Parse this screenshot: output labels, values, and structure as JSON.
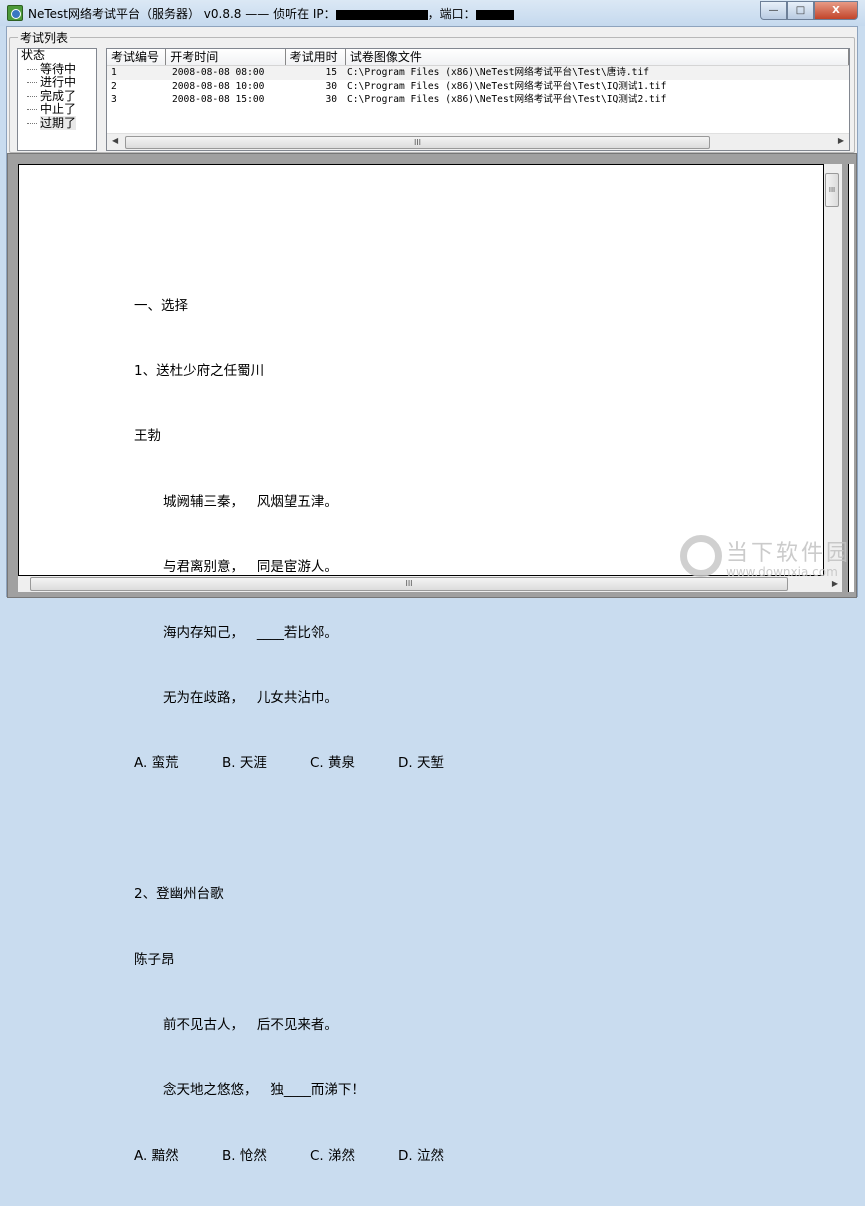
{
  "window": {
    "title": "NeTest网络考试平台（服务器） v0.8.8 —— 侦听在 IP：",
    "port_label": "，端口：",
    "minimize": "—",
    "maximize": "□",
    "close": "X"
  },
  "group": {
    "label": "考试列表"
  },
  "tree": {
    "root": "状态",
    "items": [
      "等待中",
      "进行中",
      "完成了",
      "中止了",
      "过期了"
    ]
  },
  "table": {
    "headers": [
      "考试编号",
      "开考时间",
      "考试用时",
      "试卷图像文件"
    ],
    "rows": [
      [
        "1",
        "2008-08-08 08:00",
        "15",
        "C:\\Program Files (x86)\\NeTest网络考试平台\\Test\\唐诗.tif"
      ],
      [
        "2",
        "2008-08-08 10:00",
        "30",
        "C:\\Program Files (x86)\\NeTest网络考试平台\\Test\\IQ测试1.tif"
      ],
      [
        "3",
        "2008-08-08 15:00",
        "30",
        "C:\\Program Files (x86)\\NeTest网络考试平台\\Test\\IQ测试2.tif"
      ]
    ]
  },
  "scroll": {
    "grip": "III"
  },
  "paper": {
    "section": "一、选择",
    "q1": {
      "title": "1、送杜少府之任蜀川",
      "author": "王勃",
      "lines": [
        "城阙辅三秦，   风烟望五津。",
        "与君离别意，   同是宦游人。",
        "海内存知己，   ____若比邻。",
        "无为在歧路，   儿女共沾巾。"
      ],
      "options": [
        "A. 蛮荒",
        "B. 天涯",
        "C. 黄泉",
        "D. 天堑"
      ]
    },
    "q2": {
      "title": "2、登幽州台歌",
      "author": "陈子昂",
      "lines": [
        "前不见古人，   后不见来者。",
        "念天地之悠悠，   独____而涕下！"
      ],
      "options": [
        "A. 黯然",
        "B. 怆然",
        "C. 涕然",
        "D. 泣然"
      ]
    }
  },
  "watermark": {
    "name": "当下软件园",
    "url": "www.downxia.com"
  }
}
